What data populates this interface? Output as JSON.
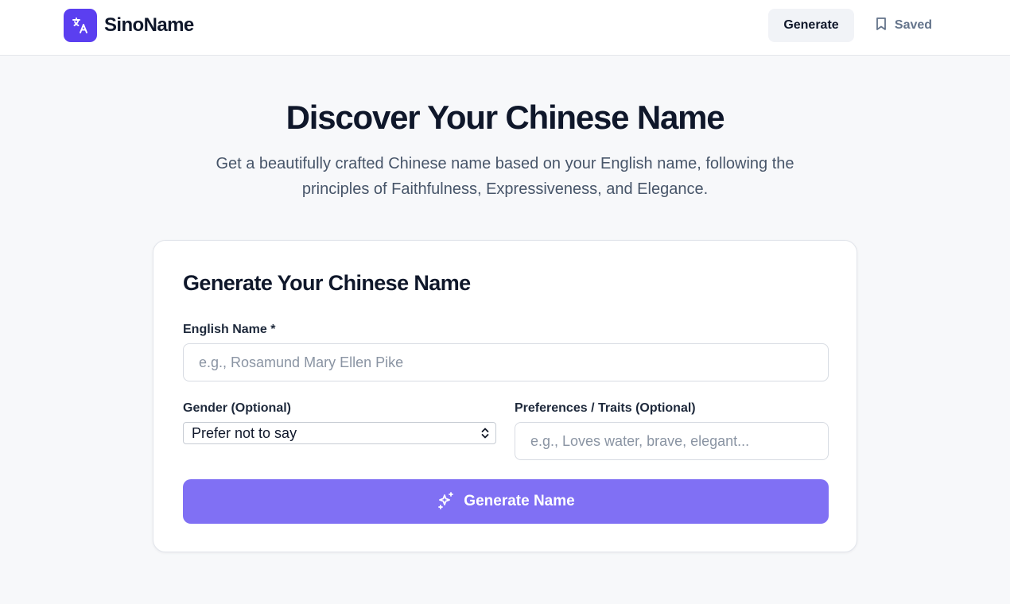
{
  "header": {
    "brand_name": "SinoName",
    "logo_icon": "translate-icon",
    "nav": {
      "generate_label": "Generate",
      "saved_label": "Saved",
      "saved_icon": "bookmark-icon"
    }
  },
  "hero": {
    "title": "Discover Your Chinese Name",
    "subtitle_line1": "Get a beautifully crafted Chinese name based on your English name, following the",
    "subtitle_line2": "principles of Faithfulness, Expressiveness, and Elegance."
  },
  "form": {
    "title": "Generate Your Chinese Name",
    "english_name": {
      "label": "English Name *",
      "value": "",
      "placeholder": "e.g., Rosamund Mary Ellen Pike"
    },
    "gender": {
      "label": "Gender (Optional)",
      "selected": "Prefer not to say"
    },
    "preferences": {
      "label": "Preferences / Traits (Optional)",
      "value": "",
      "placeholder": "e.g., Loves water, brave, elegant..."
    },
    "submit_label": "Generate Name",
    "submit_icon": "sparkles-icon"
  },
  "colors": {
    "brand": "#5b3ff0",
    "button": "#8070f4",
    "background": "#f7f8fa",
    "heading": "#0f172a",
    "muted": "#475569"
  }
}
